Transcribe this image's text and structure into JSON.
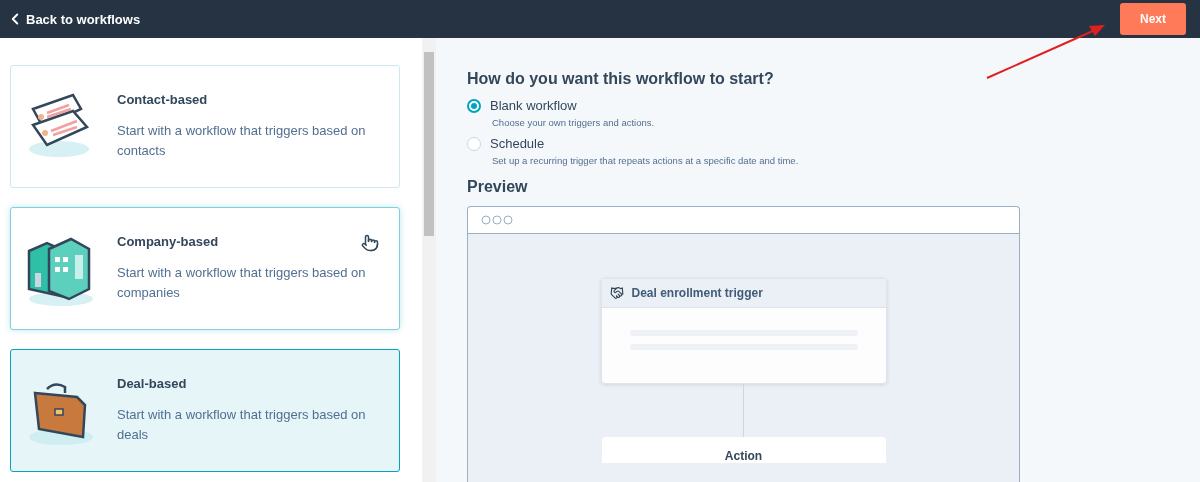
{
  "top_bar": {
    "back_link": "Back to workflows",
    "next_button": "Next"
  },
  "workflow_types": [
    {
      "kind": "contact",
      "title": "Contact-based",
      "description": "Start with a workflow that triggers based on contacts",
      "selected": false,
      "hovered": false
    },
    {
      "kind": "company",
      "title": "Company-based",
      "description": "Start with a workflow that triggers based on companies",
      "selected": false,
      "hovered": true
    },
    {
      "kind": "deal",
      "title": "Deal-based",
      "description": "Start with a workflow that triggers based on deals",
      "selected": true,
      "hovered": false
    }
  ],
  "start_question": "How do you want this workflow to start?",
  "start_options": [
    {
      "label": "Blank workflow",
      "hint": "Choose your own triggers and actions.",
      "selected": true
    },
    {
      "label": "Schedule",
      "hint": "Set up a recurring trigger that repeats actions at a specific date and time.",
      "selected": false
    }
  ],
  "preview": {
    "heading": "Preview",
    "trigger_title": "Deal enrollment trigger",
    "action_title": "Action"
  }
}
